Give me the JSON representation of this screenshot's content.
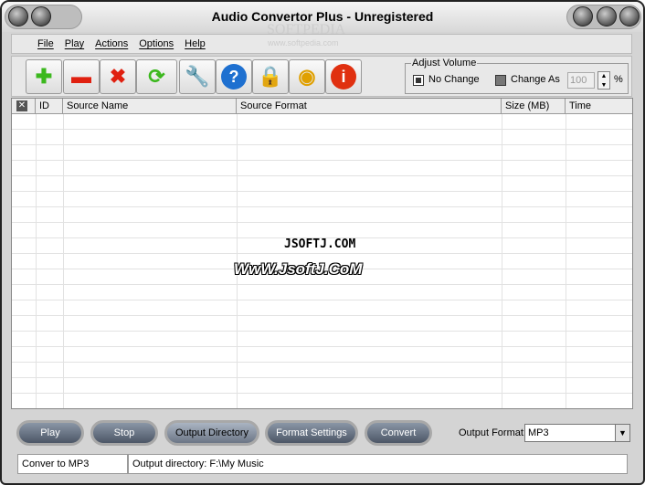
{
  "window": {
    "title": "Audio Convertor Plus - Unregistered",
    "watermark": "SOFTPEDIA",
    "watermark_url": "www.softpedia.com"
  },
  "menu": [
    "File",
    "Play",
    "Actions",
    "Options",
    "Help"
  ],
  "toolbar": {
    "buttons": [
      {
        "name": "add-icon",
        "glyph": "✚",
        "color": "#3cb81e"
      },
      {
        "name": "remove-icon",
        "glyph": "▬",
        "color": "#e02010"
      },
      {
        "name": "delete-icon",
        "glyph": "✖",
        "color": "#e02010"
      },
      {
        "name": "convert-refresh-icon",
        "glyph": "⟳",
        "color": "#3cb81e"
      },
      {
        "name": "settings-wrench-icon",
        "glyph": "🔧",
        "color": "#d8a020"
      },
      {
        "name": "help-icon",
        "glyph": "?",
        "color": "#1e70d0"
      },
      {
        "name": "register-lock-icon",
        "glyph": "🔒",
        "color": "#c8a040"
      },
      {
        "name": "buy-coins-icon",
        "glyph": "◉",
        "color": "#e0a000"
      },
      {
        "name": "info-icon",
        "glyph": "i",
        "color": "#e03010"
      }
    ]
  },
  "volume": {
    "legend": "Adjust Volume",
    "no_change": "No Change",
    "change_as": "Change As",
    "value": "100",
    "unit": "%"
  },
  "table": {
    "columns": [
      "ID",
      "Source Name",
      "Source Format",
      "Size (MB)",
      "Time"
    ],
    "rows": []
  },
  "watermarks": {
    "line1": "JSOFTJ.COM",
    "line2": "WwW.JsoftJ.CoM"
  },
  "bottom": {
    "buttons": [
      "Play",
      "Stop",
      "Output Directory",
      "Format Settings",
      "Convert"
    ],
    "output_format_label": "Output Format:",
    "output_format": "MP3"
  },
  "status": {
    "left": "Conver to MP3",
    "right": "Output directory: F:\\My Music"
  }
}
